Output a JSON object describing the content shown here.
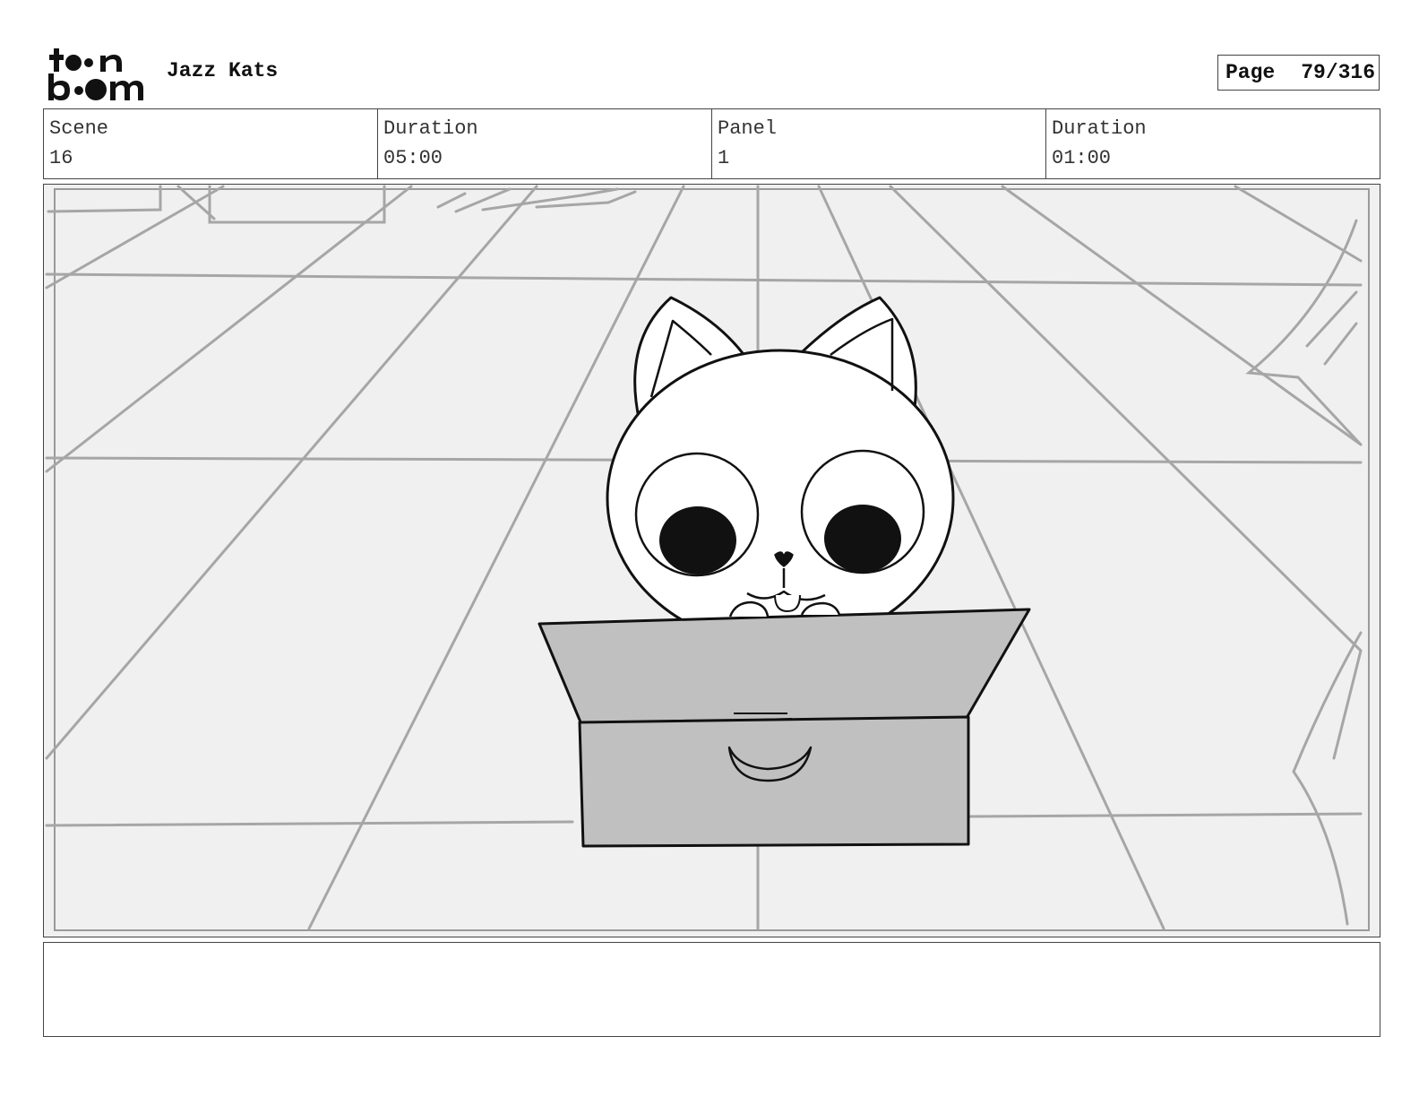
{
  "header": {
    "logo_text": "toon boom",
    "project_title": "Jazz Kats",
    "page_label": "Page",
    "page_number": "79/316"
  },
  "info": {
    "scene_label": "Scene",
    "scene_value": "16",
    "scene_duration_label": "Duration",
    "scene_duration_value": "05:00",
    "panel_label": "Panel",
    "panel_value": "1",
    "panel_duration_label": "Duration",
    "panel_duration_value": "01:00"
  },
  "drawing": {
    "subject": "cat-in-box",
    "colors": {
      "floor_background": "#f0f0f0",
      "floor_lines": "#a6a6a6",
      "box_fill": "#c0c0c0",
      "ink": "#111111"
    }
  },
  "notes": {
    "text": ""
  }
}
